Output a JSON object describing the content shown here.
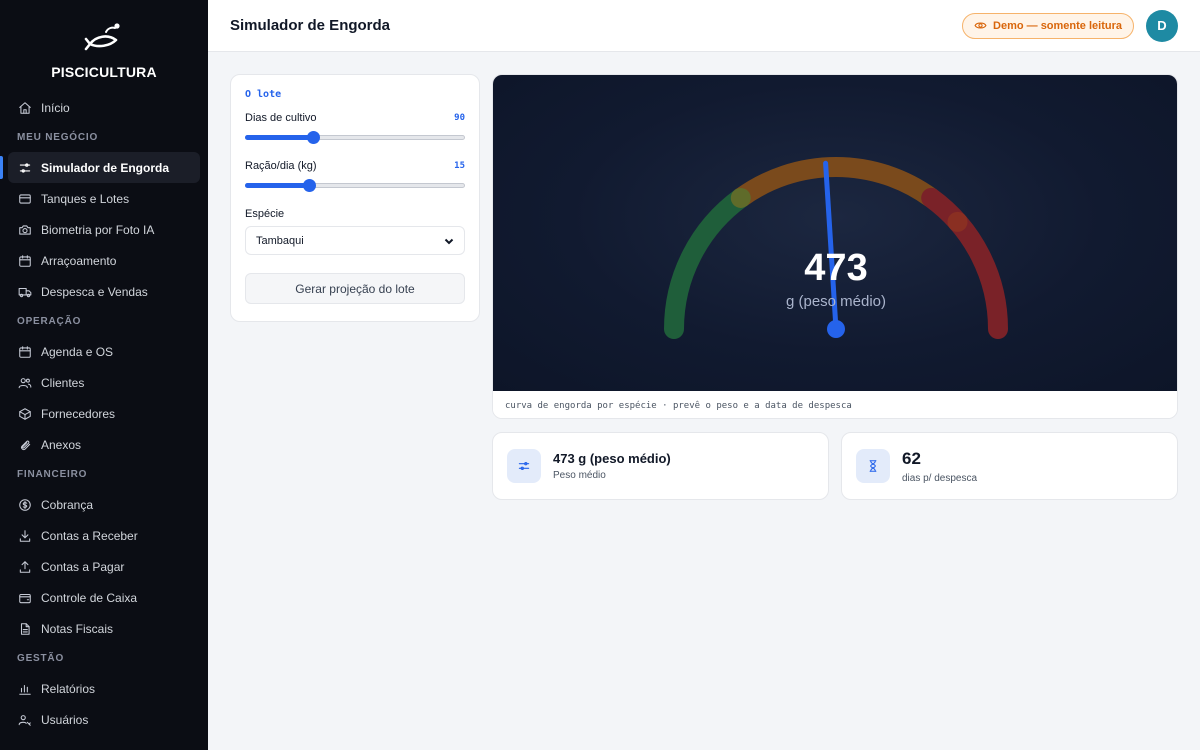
{
  "brand": {
    "name": "PISCICULTURA"
  },
  "header": {
    "title": "Simulador de Engorda",
    "demo_badge": "Demo — somente leitura",
    "avatar_initial": "D"
  },
  "sidebar": {
    "home": {
      "label": "Início",
      "icon": "home-icon"
    },
    "sections": [
      {
        "title": "MEU NEGÓCIO",
        "items": [
          {
            "label": "Simulador de Engorda",
            "icon": "sliders-icon",
            "active": true
          },
          {
            "label": "Tanques e Lotes",
            "icon": "layers-icon"
          },
          {
            "label": "Biometria por Foto IA",
            "icon": "camera-icon"
          },
          {
            "label": "Arraçoamento",
            "icon": "calendar-icon"
          },
          {
            "label": "Despesca e Vendas",
            "icon": "truck-icon"
          }
        ]
      },
      {
        "title": "OPERAÇÃO",
        "items": [
          {
            "label": "Agenda e OS",
            "icon": "calendar-icon"
          },
          {
            "label": "Clientes",
            "icon": "users-icon"
          },
          {
            "label": "Fornecedores",
            "icon": "box-icon"
          },
          {
            "label": "Anexos",
            "icon": "paperclip-icon"
          }
        ]
      },
      {
        "title": "FINANCEIRO",
        "items": [
          {
            "label": "Cobrança",
            "icon": "dollar-icon"
          },
          {
            "label": "Contas a Receber",
            "icon": "download-icon"
          },
          {
            "label": "Contas a Pagar",
            "icon": "upload-icon"
          },
          {
            "label": "Controle de Caixa",
            "icon": "wallet-icon"
          },
          {
            "label": "Notas Fiscais",
            "icon": "file-icon"
          }
        ]
      },
      {
        "title": "GESTÃO",
        "items": [
          {
            "label": "Relatórios",
            "icon": "bar-chart-icon"
          },
          {
            "label": "Usuários",
            "icon": "user-key-icon"
          }
        ]
      }
    ]
  },
  "form": {
    "title": "O lote",
    "dias": {
      "label": "Dias de cultivo",
      "value": "90",
      "fraction": 0.31
    },
    "racao": {
      "label": "Ração/dia (kg)",
      "value": "15",
      "fraction": 0.29
    },
    "especie": {
      "label": "Espécie",
      "selected": "Tambaqui"
    },
    "generate_label": "Gerar projeção do lote"
  },
  "gauge": {
    "value": "473",
    "unit": "g (peso médio)",
    "caption": "curva de engorda por espécie · prevê o peso e a data de despesca",
    "needle_fraction": 0.48,
    "colors": {
      "green": "#1f5e3a",
      "orange": "#7a4a1c",
      "red": "#7a2228",
      "needle": "#2563eb"
    }
  },
  "stats": [
    {
      "main": "473 g (peso médio)",
      "sub": "Peso médio",
      "icon": "sliders-icon"
    },
    {
      "main": "62",
      "sub": "dias p/ despesca",
      "icon": "hourglass-icon"
    }
  ],
  "colors": {
    "accent": "#2563eb",
    "sidebar_bg": "#0b0d14",
    "demo_badge": "#d9660b",
    "avatar": "#1e8aa3"
  }
}
